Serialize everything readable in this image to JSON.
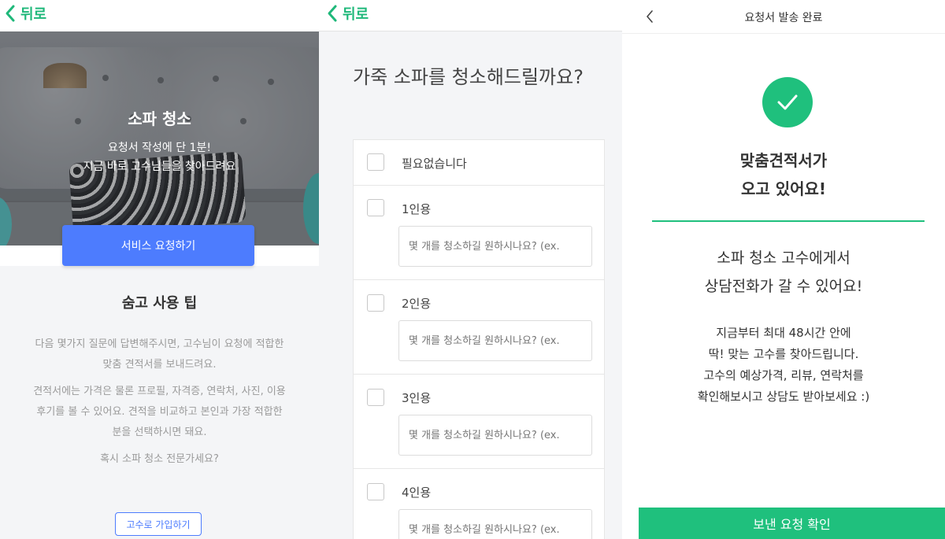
{
  "panel1": {
    "back_label": "뒤로",
    "hero_title": "소파 청소",
    "hero_sub1": "요청서 작성에 단 1분!",
    "hero_sub2": "지금 바로 고수님들을 찾아드려요",
    "cta_label": "서비스 요청하기",
    "tips_title": "숨고 사용 팁",
    "tips_p1_line1": "다음 몇가지 질문에 답변해주시면, 고수님이 요청에 적합한",
    "tips_p1_line2": "맞춤 견적서를 보내드려요.",
    "tips_p2_line1": "견적서에는 가격은 물론 프로필, 자격증, 연락처, 사진, 이용",
    "tips_p2_line2": "후기를 볼 수 있어요. 견적을 비교하고 본인과 가장 적합한",
    "tips_p2_line3": "분을 선택하시면 돼요.",
    "tips_p3": "혹시 소파 청소 전문가세요?",
    "pro_button": "고수로 가입하기"
  },
  "panel2": {
    "back_label": "뒤로",
    "question": "가죽 소파를 청소해드릴까요?",
    "options": [
      {
        "label": "필요없습니다"
      },
      {
        "label": "1인용",
        "placeholder": "몇 개를 청소하길 원하시나요? (ex."
      },
      {
        "label": "2인용",
        "placeholder": "몇 개를 청소하길 원하시나요? (ex."
      },
      {
        "label": "3인용",
        "placeholder": "몇 개를 청소하길 원하시나요? (ex."
      },
      {
        "label": "4인용",
        "placeholder": "몇 개를 청소하길 원하시나요? (ex."
      }
    ]
  },
  "panel3": {
    "header_title": "요청서 발송 완료",
    "done_line1": "맞춤견적서가",
    "done_line2": "오고 있어요!",
    "call_line1": "소파 청소 고수에게서",
    "call_line2": "상담전화가 갈 수 있어요!",
    "info_line1": "지금부터 최대 48시간 안에",
    "info_line2": "딱! 맞는 고수를 찾아드립니다.",
    "info_line3": "고수의 예상가격, 리뷰, 연락처를",
    "info_line4": "확인해보시고 상담도 받아보세요 :)",
    "confirm_button": "보낸 요청 확인"
  },
  "colors": {
    "brand_green": "#1fc07d",
    "brand_blue": "#4d7cfe"
  }
}
